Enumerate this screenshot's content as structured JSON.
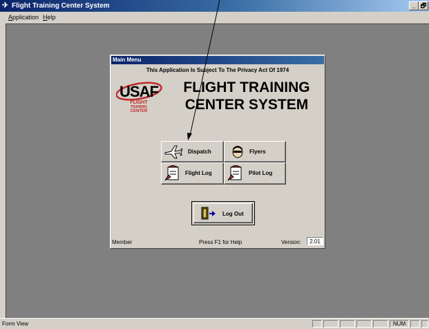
{
  "window": {
    "title": "Flight Training Center System",
    "minimize_label": "_",
    "restore_label": "🗗"
  },
  "menubar": {
    "items": [
      {
        "label": "Application"
      },
      {
        "label": "Help"
      }
    ]
  },
  "main_menu": {
    "title": "Main Menu",
    "privacy_notice": "This Application Is Subject To The Privacy Act Of 1974",
    "heading_line1": "FLIGHT TRAINING",
    "heading_line2": "CENTER SYSTEM",
    "logo": {
      "usaf": "USAF",
      "flight": "FLIGHT",
      "training": "TRAINING",
      "center": "CENTER"
    },
    "buttons": {
      "dispatch": "Dispatch",
      "flyers": "Flyers",
      "flight_log": "Flight Log",
      "pilot_log": "Pilot Log",
      "log_out": "Log Out"
    },
    "footer": {
      "user_role": "Member",
      "help_hint": "Press F1 for Help",
      "version_label": "Version:",
      "version_value": "2.01"
    }
  },
  "statusbar": {
    "status_text": "Form View",
    "num_indicator": "NUM"
  },
  "colors": {
    "titlebar_start": "#0a246a",
    "titlebar_end": "#a6caf0",
    "workspace": "#808080",
    "face": "#d4d0c8",
    "logo_red": "#c0282d"
  }
}
